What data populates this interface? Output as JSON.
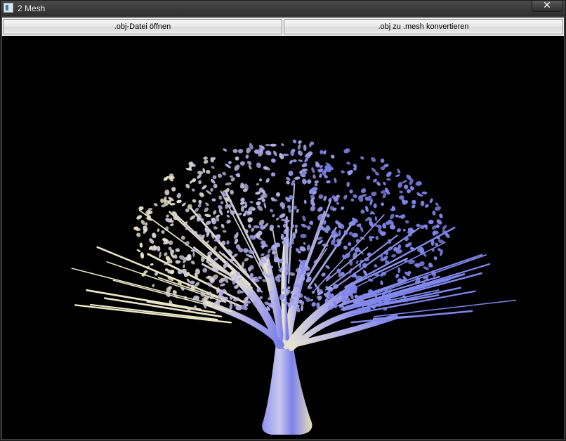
{
  "window": {
    "title": "2 Mesh",
    "close_glyph": "✕"
  },
  "toolbar": {
    "open_obj_label": ".obj-Datei öffnen",
    "convert_label": ".obj zu .mesh konvertieren"
  },
  "viewport": {
    "background": "#000000",
    "model": "tree-mesh",
    "colors": {
      "cool": "#7f86ec",
      "warm": "#ece7c8",
      "mid": "#b7b2e6"
    }
  }
}
